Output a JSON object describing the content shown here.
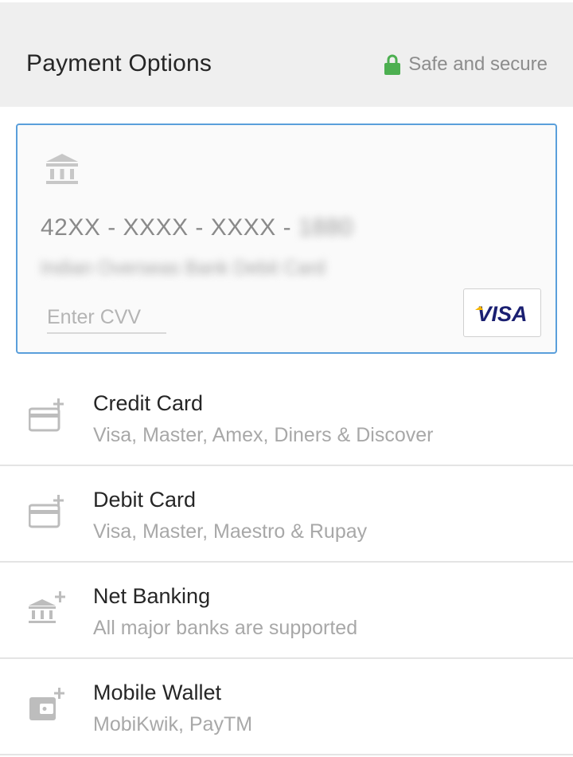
{
  "header": {
    "title": "Payment Options",
    "secure_label": "Safe and secure",
    "lock_color": "#4caf50",
    "lock_icon": "lock-icon"
  },
  "saved_card": {
    "icon": "bank-icon",
    "number_prefix": "42XX - XXXX - XXXX - ",
    "number_suffix": "1880",
    "bank_name": "Indian Overseas Bank Debit Card",
    "cvv_placeholder": "Enter CVV",
    "cvv_value": "",
    "network": "VISA",
    "border_color": "#5a9fdb"
  },
  "options": [
    {
      "title": "Credit Card",
      "subtitle": "Visa, Master, Amex, Diners & Discover",
      "icon": "add-card-icon"
    },
    {
      "title": "Debit Card",
      "subtitle": "Visa, Master, Maestro & Rupay",
      "icon": "add-card-icon"
    },
    {
      "title": "Net Banking",
      "subtitle": "All major banks are supported",
      "icon": "add-bank-icon"
    },
    {
      "title": "Mobile Wallet",
      "subtitle": "MobiKwik, PayTM",
      "icon": "add-wallet-icon"
    }
  ]
}
